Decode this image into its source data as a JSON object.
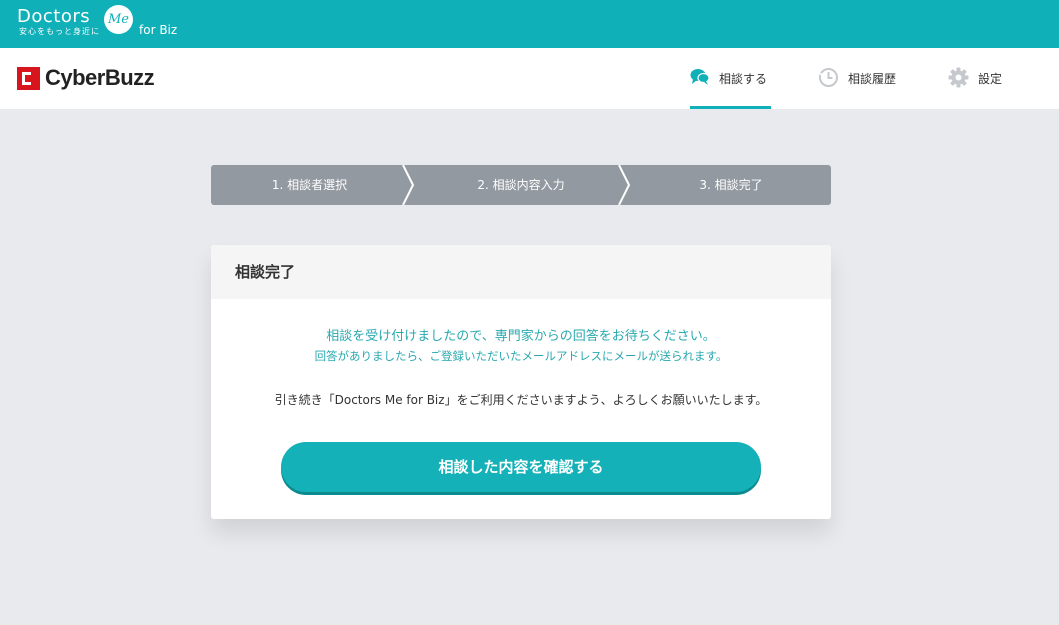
{
  "topbar": {
    "brand_main": "Doctors",
    "brand_me": "Me",
    "brand_tagline": "安心をもっと身近に",
    "brand_suffix": "for Biz",
    "color": "#0fb0b8"
  },
  "header": {
    "logo_text": "CyberBuzz",
    "nav": [
      {
        "label": "相談する",
        "icon": "chat-bubbles-icon",
        "active": true
      },
      {
        "label": "相談履歴",
        "icon": "history-clock-icon",
        "active": false
      },
      {
        "label": "設定",
        "icon": "gear-icon",
        "active": false
      }
    ]
  },
  "steps": [
    {
      "label": "1. 相談者選択"
    },
    {
      "label": "2. 相談内容入力"
    },
    {
      "label": "3. 相談完了"
    }
  ],
  "card": {
    "title": "相談完了",
    "message_line1": "相談を受け付けましたので、専門家からの回答をお待ちください。",
    "message_line2": "回答がありましたら、ご登録いただいたメールアドレスにメールが送られます。",
    "message_line3": "引き続き「Doctors Me for Biz」をご利用くださいますよう、よろしくお願いいたします。",
    "button_label": "相談した内容を確認する"
  },
  "colors": {
    "accent": "#0fb0b8",
    "step_bg": "#9399a0",
    "logo_red": "#d8141e"
  }
}
